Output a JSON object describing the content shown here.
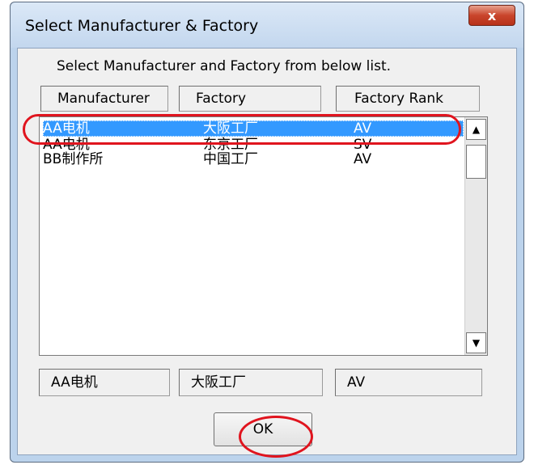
{
  "window": {
    "title": "Select Manufacturer & Factory",
    "close_label": "x"
  },
  "dialog": {
    "instruction": "Select Manufacturer and Factory from below list."
  },
  "columns": {
    "manufacturer": "Manufacturer",
    "factory": "Factory",
    "rank": "Factory Rank"
  },
  "rows": [
    {
      "manufacturer": "AA电机",
      "factory": "大阪工厂",
      "rank": "AV",
      "selected": true
    },
    {
      "manufacturer": "AA电机",
      "factory": "东京工厂",
      "rank": "SV",
      "selected": false
    },
    {
      "manufacturer": "BB制作所",
      "factory": "中国工厂",
      "rank": "AV",
      "selected": false
    }
  ],
  "selection": {
    "manufacturer": "AA电机",
    "factory": "大阪工厂",
    "rank": "AV"
  },
  "buttons": {
    "ok_label": "OK"
  },
  "scrollbar": {
    "up_icon": "▲",
    "down_icon": "▼"
  },
  "colors": {
    "selection_bg": "#3399ff",
    "callout": "#e0141e",
    "close_button": "#c9452c"
  }
}
